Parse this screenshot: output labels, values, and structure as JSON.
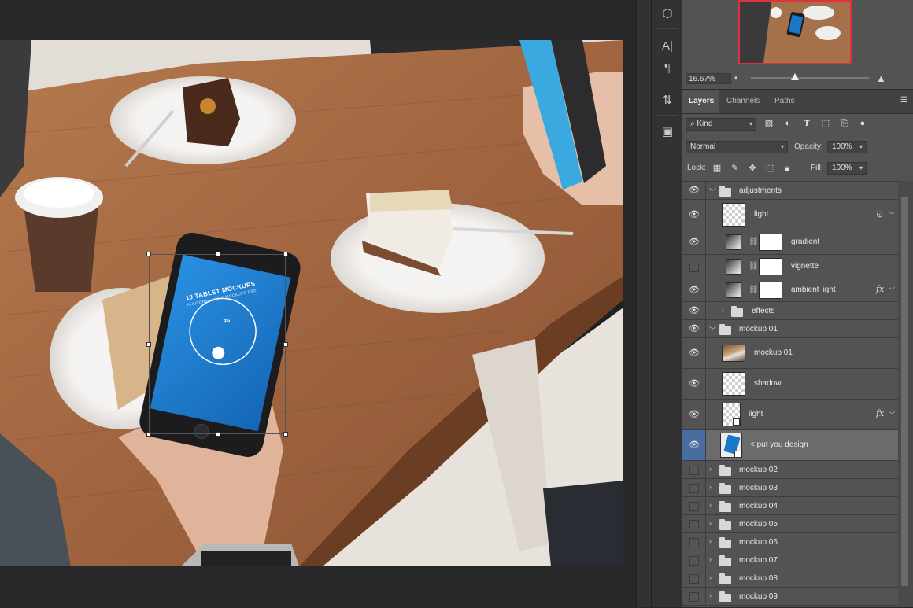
{
  "canvas": {
    "screen_title": "10 TABLET MOCKUPS",
    "screen_subtitle": "PHOTOREALISTIC MOCKUPS PSD",
    "screen_brand": "RS"
  },
  "tools": [
    {
      "name": "3d-cube-icon",
      "glyph": "⬡"
    },
    {
      "name": "character-panel-icon",
      "glyph": "A|"
    },
    {
      "name": "paragraph-panel-icon",
      "glyph": "¶"
    },
    {
      "name": "clone-source-icon",
      "glyph": "⇅"
    },
    {
      "name": "properties-icon",
      "glyph": "▣"
    }
  ],
  "navigator": {
    "zoom": "16.67%"
  },
  "layers_panel": {
    "tabs": [
      "Layers",
      "Channels",
      "Paths"
    ],
    "active_tab": "Layers",
    "filter_kind": "Kind",
    "blend_mode": "Normal",
    "opacity_label": "Opacity:",
    "opacity_value": "100%",
    "lock_label": "Lock:",
    "fill_label": "Fill:",
    "fill_value": "100%"
  },
  "layers": [
    {
      "name": "adjustments",
      "type": "group",
      "visible": true,
      "expanded": true
    },
    {
      "name": "light",
      "type": "layer",
      "visible": true,
      "thumb": "checker"
    },
    {
      "name": "gradient",
      "type": "adjustment",
      "visible": true
    },
    {
      "name": "vignette",
      "type": "adjustment",
      "visible": false
    },
    {
      "name": "ambient light",
      "type": "adjustment",
      "visible": true,
      "fx": "fx"
    },
    {
      "name": "effects",
      "type": "group",
      "visible": true,
      "expanded": false
    },
    {
      "name": "mockup 01",
      "type": "group",
      "visible": true,
      "expanded": true
    },
    {
      "name": "mockup 01",
      "type": "layer",
      "visible": true,
      "thumb": "photo"
    },
    {
      "name": "shadow",
      "type": "layer",
      "visible": true,
      "thumb": "checker"
    },
    {
      "name": "light",
      "type": "smart",
      "visible": true,
      "thumb": "checker",
      "fx": "fx"
    },
    {
      "name": "< put you design",
      "type": "smart",
      "visible": true,
      "thumb": "design",
      "selected": true
    },
    {
      "name": "mockup 02",
      "type": "group",
      "visible": false
    },
    {
      "name": "mockup 03",
      "type": "group",
      "visible": false
    },
    {
      "name": "mockup 04",
      "type": "group",
      "visible": false
    },
    {
      "name": "mockup 05",
      "type": "group",
      "visible": false
    },
    {
      "name": "mockup 06",
      "type": "group",
      "visible": false
    },
    {
      "name": "mockup 07",
      "type": "group",
      "visible": false
    },
    {
      "name": "mockup 08",
      "type": "group",
      "visible": false
    },
    {
      "name": "mockup 09",
      "type": "group",
      "visible": false
    }
  ],
  "colors": {
    "app_bg": "#282828",
    "panel_bg": "#535353",
    "selected_row": "#6b6b6b",
    "navigator_frame": "#e0323e",
    "phone_screen": "#1a78c8"
  }
}
